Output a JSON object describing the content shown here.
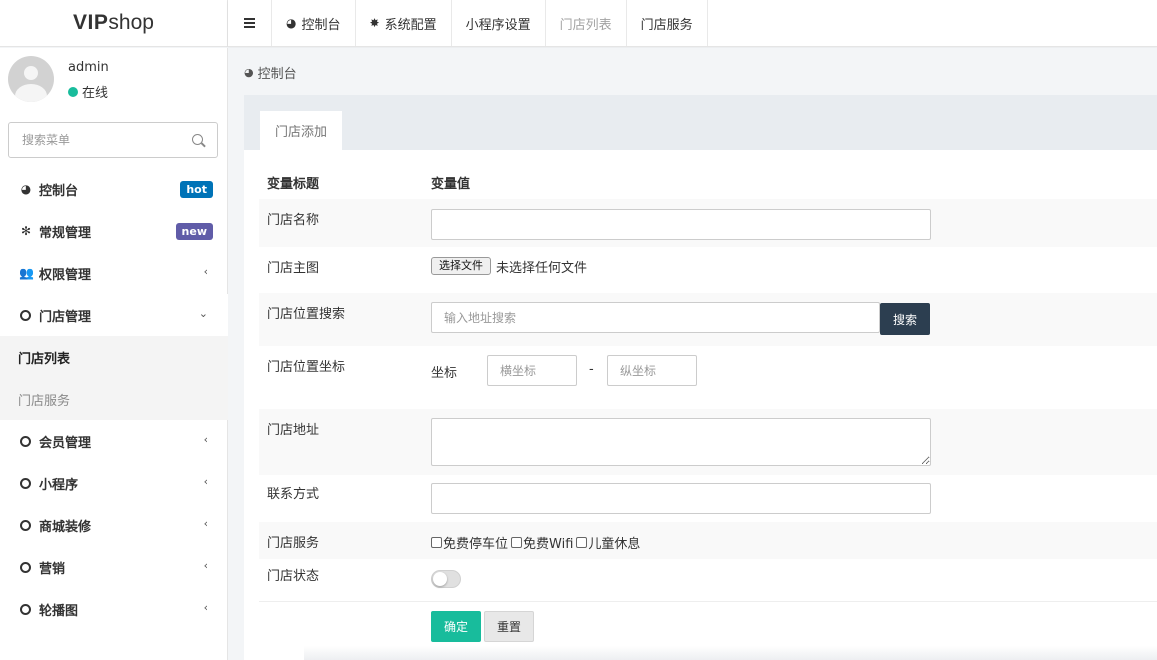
{
  "logo": {
    "bold": "VIP",
    "light": "shop"
  },
  "topnav": {
    "tabs": [
      {
        "icon": "dashboard-icon",
        "glyph": "⚙",
        "label": "控制台"
      },
      {
        "icon": "cog-icon",
        "glyph": "⚙",
        "label": "系统配置"
      },
      {
        "label": "小程序设置"
      },
      {
        "label": "门店列表"
      },
      {
        "label": "门店服务"
      }
    ]
  },
  "user": {
    "name": "admin",
    "status": "在线",
    "status_color": "#18bc9c"
  },
  "sidebar": {
    "search_placeholder": "搜索菜单",
    "items": [
      {
        "label": "控制台",
        "badge": "hot",
        "badge_color": "#0073b7"
      },
      {
        "label": "常规管理",
        "badge": "new",
        "badge_color": "#605ca8"
      },
      {
        "label": "权限管理",
        "arrow": "‹"
      },
      {
        "label": "门店管理",
        "arrow": "⌄"
      },
      {
        "label": "门店列表"
      },
      {
        "label": "门店服务"
      },
      {
        "label": "会员管理",
        "arrow": "‹"
      },
      {
        "label": "小程序",
        "arrow": "‹"
      },
      {
        "label": "商城装修",
        "arrow": "‹"
      },
      {
        "label": "营销",
        "arrow": "‹"
      },
      {
        "label": "轮播图",
        "arrow": "‹"
      }
    ]
  },
  "breadcrumb": {
    "label": "控制台"
  },
  "panel": {
    "tab": "门店添加"
  },
  "form": {
    "header_title": "变量标题",
    "header_value": "变量值",
    "store_name_label": "门店名称",
    "store_image_label": "门店主图",
    "file_button": "选择文件",
    "file_status": "未选择任何文件",
    "location_search_label": "门店位置搜索",
    "location_search_placeholder": "输入地址搜索",
    "search_button": "搜索",
    "coord_label": "门店位置坐标",
    "coord_text": "坐标",
    "lng_placeholder": "横坐标",
    "dash": "-",
    "lat_placeholder": "纵坐标",
    "address_label": "门店地址",
    "contact_label": "联系方式",
    "service_label": "门店服务",
    "services": [
      "免费停车位",
      "免费Wifi",
      "儿童休息"
    ],
    "status_label": "门店状态",
    "status_on": false,
    "confirm_button": "确定",
    "reset_button": "重置"
  },
  "colors": {
    "accent": "#18bc9c",
    "dark": "#2c3e50"
  }
}
